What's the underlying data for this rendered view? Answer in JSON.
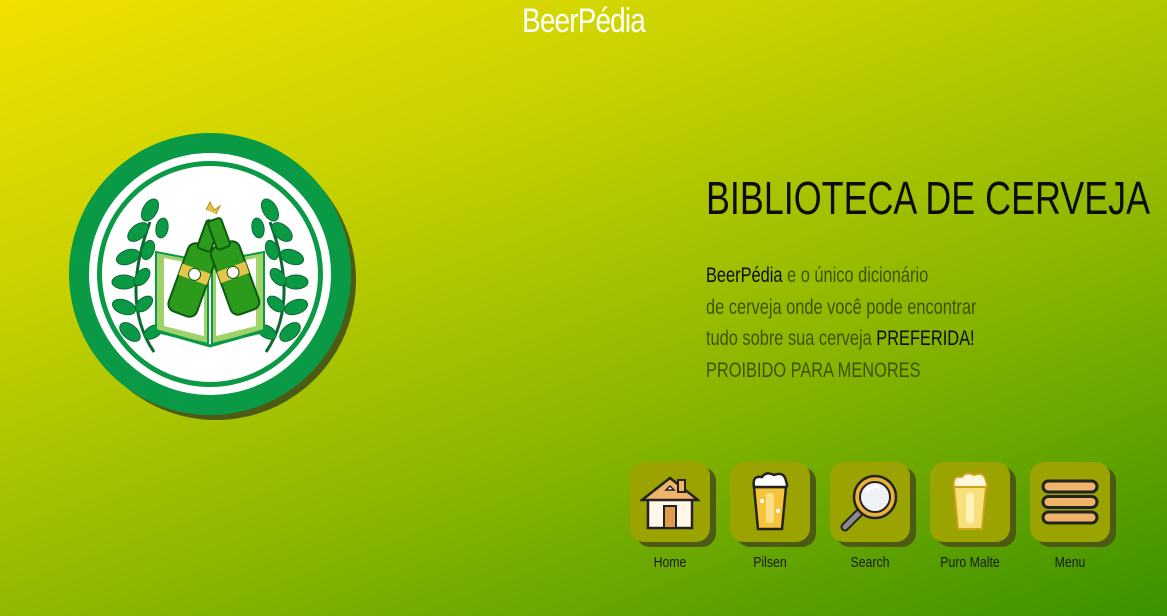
{
  "header": {
    "brand": "BeerPédia"
  },
  "hero": {
    "title": "BIBLIOTECA DE CERVEJA",
    "desc_line1_brand": "BeerPédia",
    "desc_line1_rest": " e o único dicionário",
    "desc_line2": "de cerveja onde você pode encontrar",
    "desc_line3_a": "tudo sobre sua cerveja ",
    "desc_line3_b": "PREFERIDA!",
    "desc_line4": "PROIBIDO PARA MENORES"
  },
  "logo": {
    "icon": "beer-book-laurel-logo"
  },
  "nav": {
    "items": [
      {
        "label": "Home",
        "icon": "house-icon"
      },
      {
        "label": "Pilsen",
        "icon": "beer-glass-icon"
      },
      {
        "label": "Search",
        "icon": "magnifier-icon"
      },
      {
        "label": "Puro Malte",
        "icon": "malt-beer-icon"
      },
      {
        "label": "Menu",
        "icon": "hamburger-menu-icon"
      }
    ]
  },
  "colors": {
    "gradient_start": "#f2e000",
    "gradient_end": "#3c9200",
    "tile": "#9aa300",
    "tile_shadow": "#4d5a14",
    "logo_green": "#0a9a45"
  }
}
